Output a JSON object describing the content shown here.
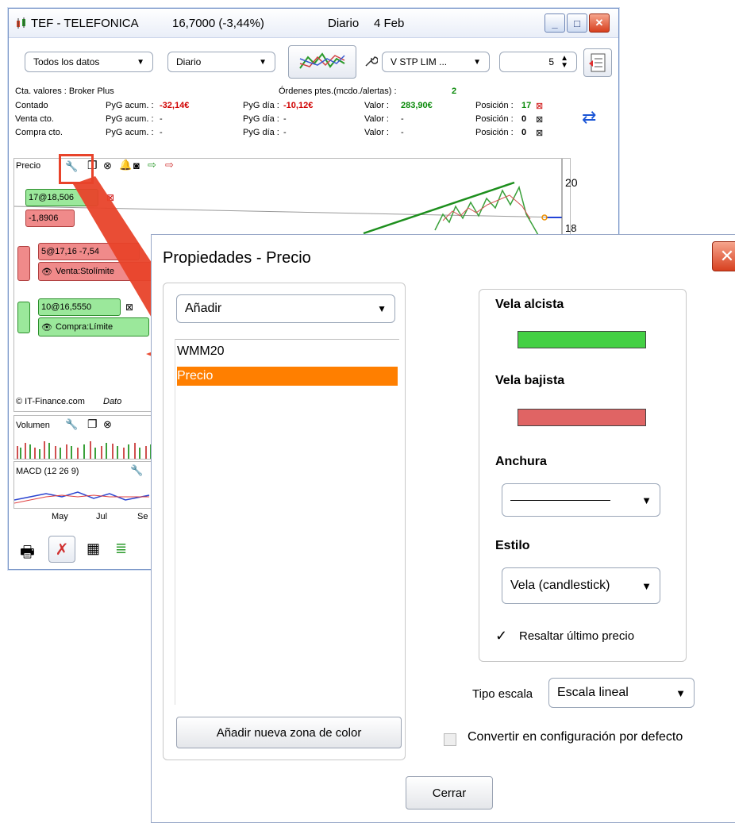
{
  "window": {
    "title": "TEF - TELEFONICA",
    "price": "16,7000 (-3,44%)",
    "period": "Diario",
    "date": "4 Feb"
  },
  "toolbar": {
    "data_select": "Todos los datos",
    "interval_select": "Diario",
    "order_select": "V STP LIM ...",
    "quantity": "5"
  },
  "account": {
    "label": "Cta. valores : Broker Plus",
    "pending": "Órdenes ptes.(mcdo./alertas) :",
    "pending_count": "2",
    "rows": [
      {
        "name": "Contado",
        "pyg_acum_label": "PyG acum. :",
        "pyg_acum": "-32,14€",
        "pyg_dia_label": "PyG día :",
        "pyg_dia": "-10,12€",
        "valor_label": "Valor :",
        "valor": "283,90€",
        "pos_label": "Posición :",
        "pos": "17"
      },
      {
        "name": "Venta cto.",
        "pyg_acum_label": "PyG acum. :",
        "pyg_acum": "-",
        "pyg_dia_label": "PyG día :",
        "pyg_dia": "-",
        "valor_label": "Valor :",
        "valor": "-",
        "pos_label": "Posición :",
        "pos": "0"
      },
      {
        "name": "Compra cto.",
        "pyg_acum_label": "PyG acum. :",
        "pyg_acum": "-",
        "pyg_dia_label": "PyG día :",
        "pyg_dia": "-",
        "valor_label": "Valor :",
        "valor": "-",
        "pos_label": "Posición :",
        "pos": "0"
      }
    ]
  },
  "chart": {
    "panel_label": "Precio",
    "axis_ticks": [
      "20",
      "18"
    ],
    "position_tag": "17@18,5",
    "position_tag_suffix": "06",
    "pl_tag": "-1,8906",
    "sell_tag": "5@17,16 - ",
    "sell_tag_suffix": "7,54",
    "sell_label": "Venta:Sto",
    "sell_label_suffix": "límite",
    "buy_tag": "10@16,5550",
    "buy_label": "Compra:Límite",
    "copyright": "© IT-Finance.com",
    "copyright_suffix": "Dato",
    "volume_label": "Volumen",
    "macd_label": "MACD (12 26 9)",
    "months": [
      "May",
      "Jul",
      "Se"
    ]
  },
  "dialog": {
    "title": "Propiedades - Precio",
    "add_select": "Añadir",
    "list_items": [
      "WMM20",
      "Precio"
    ],
    "selected_item": "Precio",
    "add_zone_button": "Añadir nueva zona de color",
    "bull_label": "Vela alcista",
    "bull_color": "#44d044",
    "bear_label": "Vela bajista",
    "bear_color": "#e06464",
    "width_label": "Anchura",
    "style_label": "Estilo",
    "style_value": "Vela (candlestick)",
    "highlight_label": "Resaltar último precio",
    "highlight_checked": true,
    "scale_label": "Tipo escala",
    "scale_value": "Escala lineal",
    "default_label": "Convertir en configuración por defecto",
    "close_button": "Cerrar"
  },
  "colors": {
    "accent_orange": "#ff7f00",
    "arrow_red": "#e8432a",
    "tag_green": "#9be89b",
    "tag_red": "#f08a8a"
  },
  "icons": [
    "chart-candle-icon",
    "wrench-icon",
    "window-icon",
    "close-circle-icon",
    "bell-icon",
    "order-icon",
    "print-icon",
    "minimize-icon",
    "maximize-icon",
    "close-icon",
    "stepper-icon",
    "swap-arrows-icon",
    "checkbox-icon"
  ]
}
